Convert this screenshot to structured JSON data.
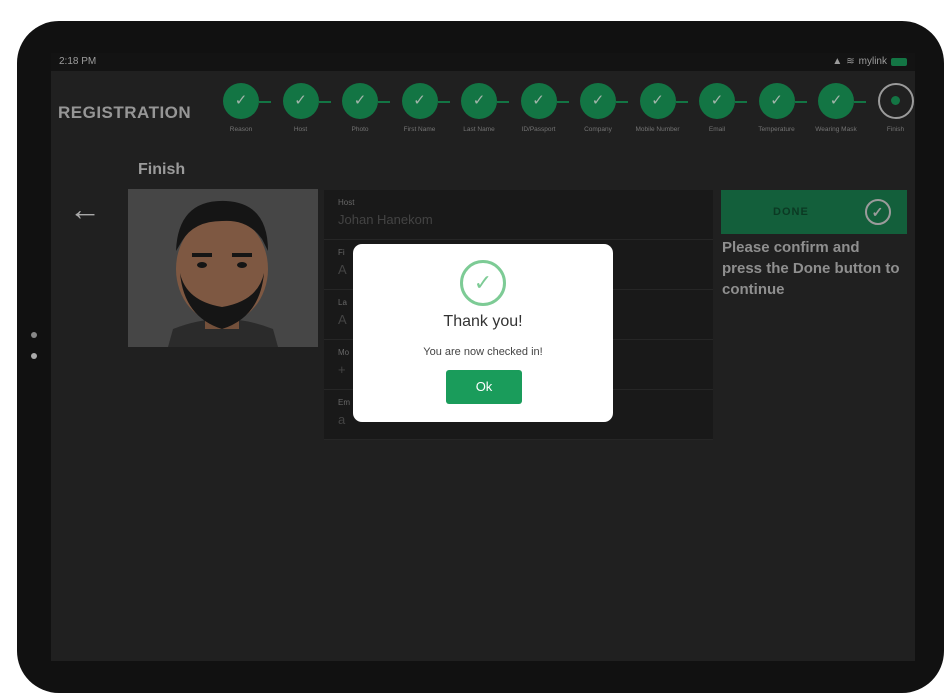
{
  "status_bar": {
    "time": "2:18 PM",
    "network": "mylink"
  },
  "header": {
    "title": "REGISTRATION"
  },
  "steps": [
    {
      "label": "Reason",
      "done": true
    },
    {
      "label": "Host",
      "done": true
    },
    {
      "label": "Photo",
      "done": true
    },
    {
      "label": "First Name",
      "done": true
    },
    {
      "label": "Last Name",
      "done": true
    },
    {
      "label": "ID/Passport",
      "done": true
    },
    {
      "label": "Company",
      "done": true
    },
    {
      "label": "Mobile Number",
      "done": true
    },
    {
      "label": "Email",
      "done": true
    },
    {
      "label": "Temperature",
      "done": true
    },
    {
      "label": "Wearing Mask",
      "done": true
    },
    {
      "label": "Finish",
      "done": false
    }
  ],
  "page": {
    "heading": "Finish"
  },
  "form": {
    "rows": [
      {
        "label": "Host",
        "value": "Johan Hanekom"
      },
      {
        "label": "Fi",
        "value": "A"
      },
      {
        "label": "La",
        "value": "A"
      },
      {
        "label": "Mo",
        "value": "+"
      },
      {
        "label": "Em",
        "value": "a"
      }
    ]
  },
  "done_button": {
    "label": "DONE"
  },
  "instructions": "Please confirm and press the Done button to continue",
  "modal": {
    "title": "Thank you!",
    "message": "You are now checked in!",
    "ok_label": "Ok"
  },
  "colors": {
    "accent": "#1a9c5b",
    "background": "#2b2b2b",
    "success": "#7dcb95"
  }
}
